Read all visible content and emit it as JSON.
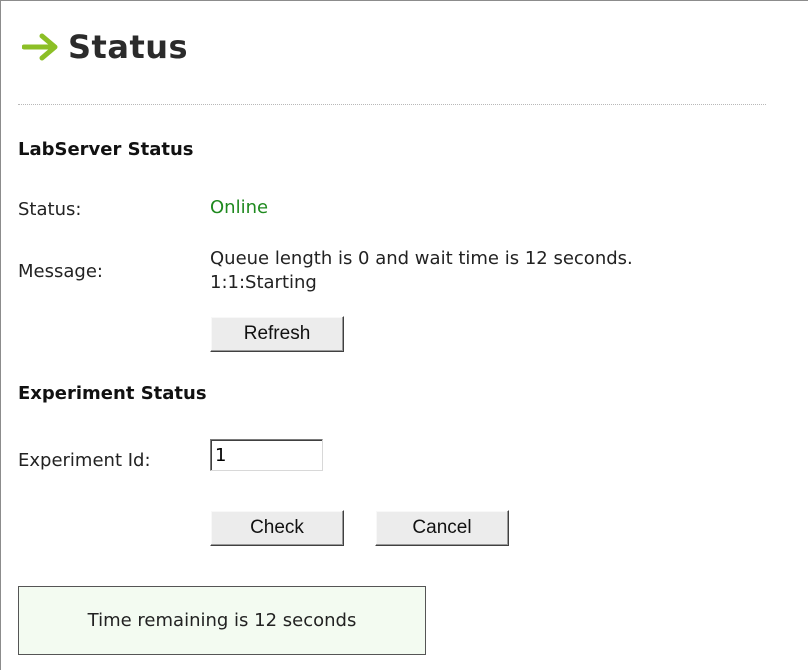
{
  "header": {
    "title": "Status",
    "arrow_icon": "arrow-right-icon",
    "arrow_color": "#8cbf26"
  },
  "labserver": {
    "heading": "LabServer Status",
    "status_label": "Status:",
    "status_value": "Online",
    "status_color": "#1f8a1f",
    "message_label": "Message:",
    "message_line1": "Queue length is 0 and wait time is 12 seconds.",
    "message_line2": "1:1:Starting",
    "refresh_label": "Refresh"
  },
  "experiment": {
    "heading": "Experiment Status",
    "id_label": "Experiment Id:",
    "id_value": "1",
    "check_label": "Check",
    "cancel_label": "Cancel"
  },
  "result": {
    "text": "Time remaining is 12 seconds",
    "background": "#f3fbf1"
  }
}
